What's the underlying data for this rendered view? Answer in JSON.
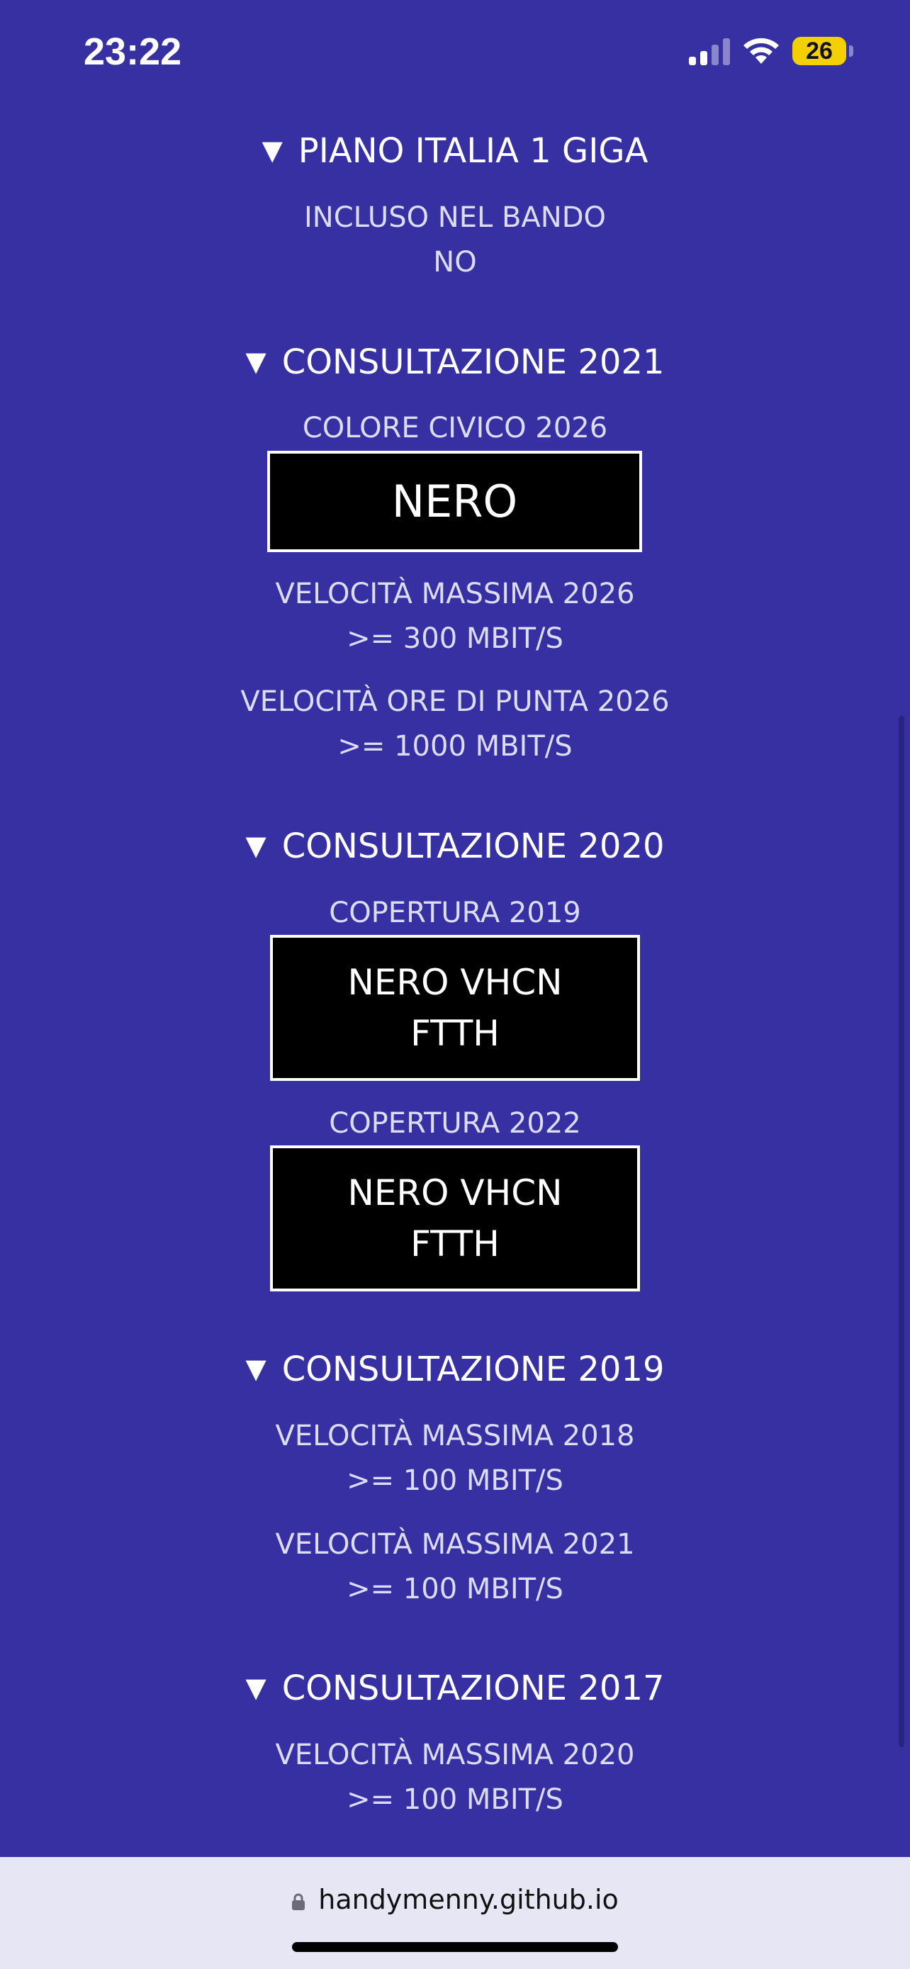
{
  "status_bar": {
    "time": "23:22",
    "battery": "26"
  },
  "sections": {
    "piano": {
      "title": "PIANO ITALIA 1 GIGA",
      "incluso_label": "INCLUSO NEL BANDO",
      "incluso_value": "NO"
    },
    "c2021": {
      "title": "CONSULTAZIONE 2021",
      "colore_label": "COLORE CIVICO 2026",
      "colore_value": "NERO",
      "vel_max_label": "VELOCITÀ MASSIMA 2026",
      "vel_max_value": ">= 300 MBIT/S",
      "vel_punta_label": "VELOCITÀ ORE DI PUNTA 2026",
      "vel_punta_value": ">= 1000 MBIT/S"
    },
    "c2020": {
      "title": "CONSULTAZIONE 2020",
      "cop2019_label": "COPERTURA 2019",
      "cop2019_line1": "NERO VHCN",
      "cop2019_line2": "FTTH",
      "cop2022_label": "COPERTURA 2022",
      "cop2022_line1": "NERO VHCN",
      "cop2022_line2": "FTTH"
    },
    "c2019": {
      "title": "CONSULTAZIONE 2019",
      "vel2018_label": "VELOCITÀ MASSIMA 2018",
      "vel2018_value": ">= 100 MBIT/S",
      "vel2021_label": "VELOCITÀ MASSIMA 2021",
      "vel2021_value": ">= 100 MBIT/S"
    },
    "c2017": {
      "title": "CONSULTAZIONE 2017",
      "vel2020_label": "VELOCITÀ MASSIMA 2020",
      "vel2020_value": ">= 100 MBIT/S"
    }
  },
  "browser": {
    "url": "handymenny.github.io"
  },
  "colors": {
    "background": "#3730a3",
    "label_text": "#dcdcf5",
    "box_fill": "#000000",
    "box_border": "#ffffff",
    "battery": "#f5d000",
    "url_bar": "#e6e6f5"
  },
  "icons": {
    "disclosure": "▼",
    "signal": "cellular-signal-icon",
    "wifi": "wifi-icon",
    "lock": "lock-icon"
  }
}
